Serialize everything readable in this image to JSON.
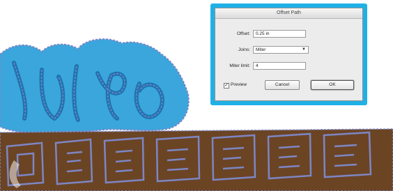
{
  "dialog": {
    "title": "Offset Path",
    "offset_label": "Offset:",
    "offset_value": "0.25 in",
    "joins_label": "Joins:",
    "joins_value": "Miter",
    "miter_label": "Miter limit:",
    "miter_value": "4",
    "preview_label": "Preview",
    "preview_checked": true,
    "cancel_label": "Cancel",
    "ok_label": "OK"
  },
  "colors": {
    "dialog_frame": "#1fb1e6",
    "script_text_light": "#3aa6dc",
    "script_text_dark": "#2a86c0",
    "block_text_brown": "#6b4424",
    "path_outline": "#7d86c4"
  },
  "icons": {
    "checkbox": "check-mark",
    "dropdown": "chevron-down-icon"
  }
}
